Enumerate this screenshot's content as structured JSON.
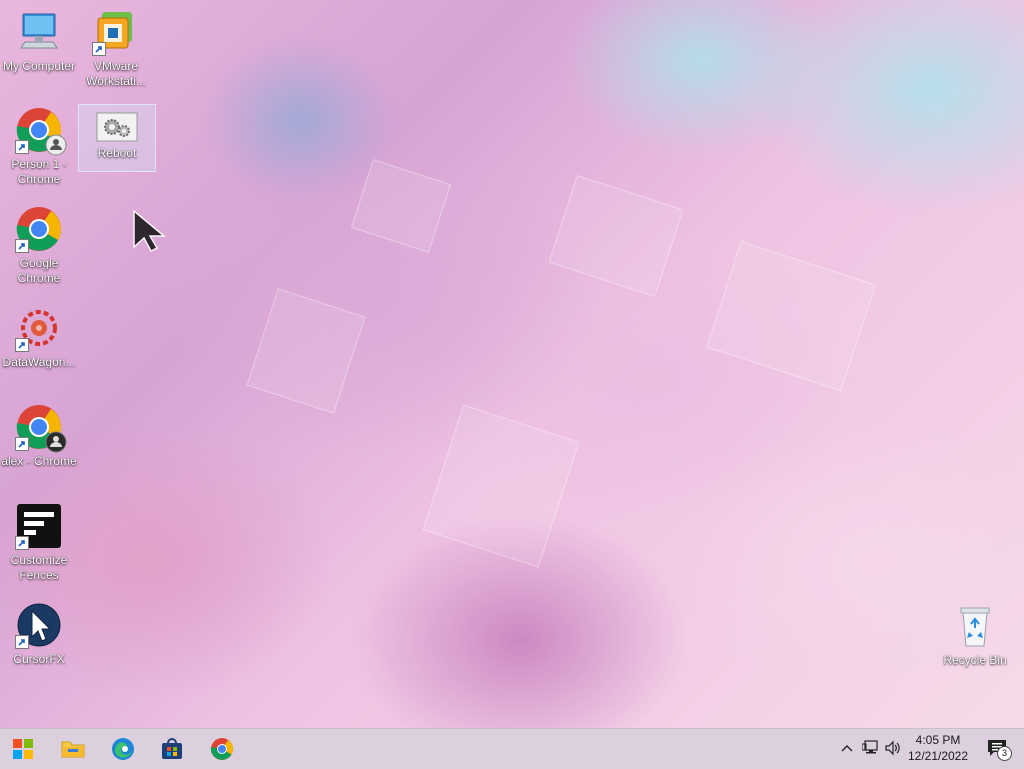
{
  "desktop_icons": [
    {
      "id": "my-computer",
      "label": "My Computer"
    },
    {
      "id": "vmware",
      "label": "VMware Workstati..."
    },
    {
      "id": "person1-chrome",
      "label": "Person 1 - Chrome"
    },
    {
      "id": "reboot",
      "label": "Reboot"
    },
    {
      "id": "google-chrome",
      "label": "Google Chrome"
    },
    {
      "id": "datawagon",
      "label": "DataWagon..."
    },
    {
      "id": "alex-chrome",
      "label": "alex - Chrome"
    },
    {
      "id": "customize-fences",
      "label": "Customize Fences"
    },
    {
      "id": "cursorfx",
      "label": "CursorFX"
    },
    {
      "id": "recycle-bin",
      "label": "Recycle Bin"
    }
  ],
  "taskbar": {
    "pinned": [
      "start-icon",
      "file-explorer-icon",
      "edge-icon",
      "store-icon",
      "chrome-icon"
    ],
    "tray": {
      "time": "4:05 PM",
      "date": "12/21/2022",
      "notification_count": "3"
    }
  },
  "colors": {
    "taskbar_bg": "#dcd0df",
    "start_blue": "#0078d4"
  }
}
